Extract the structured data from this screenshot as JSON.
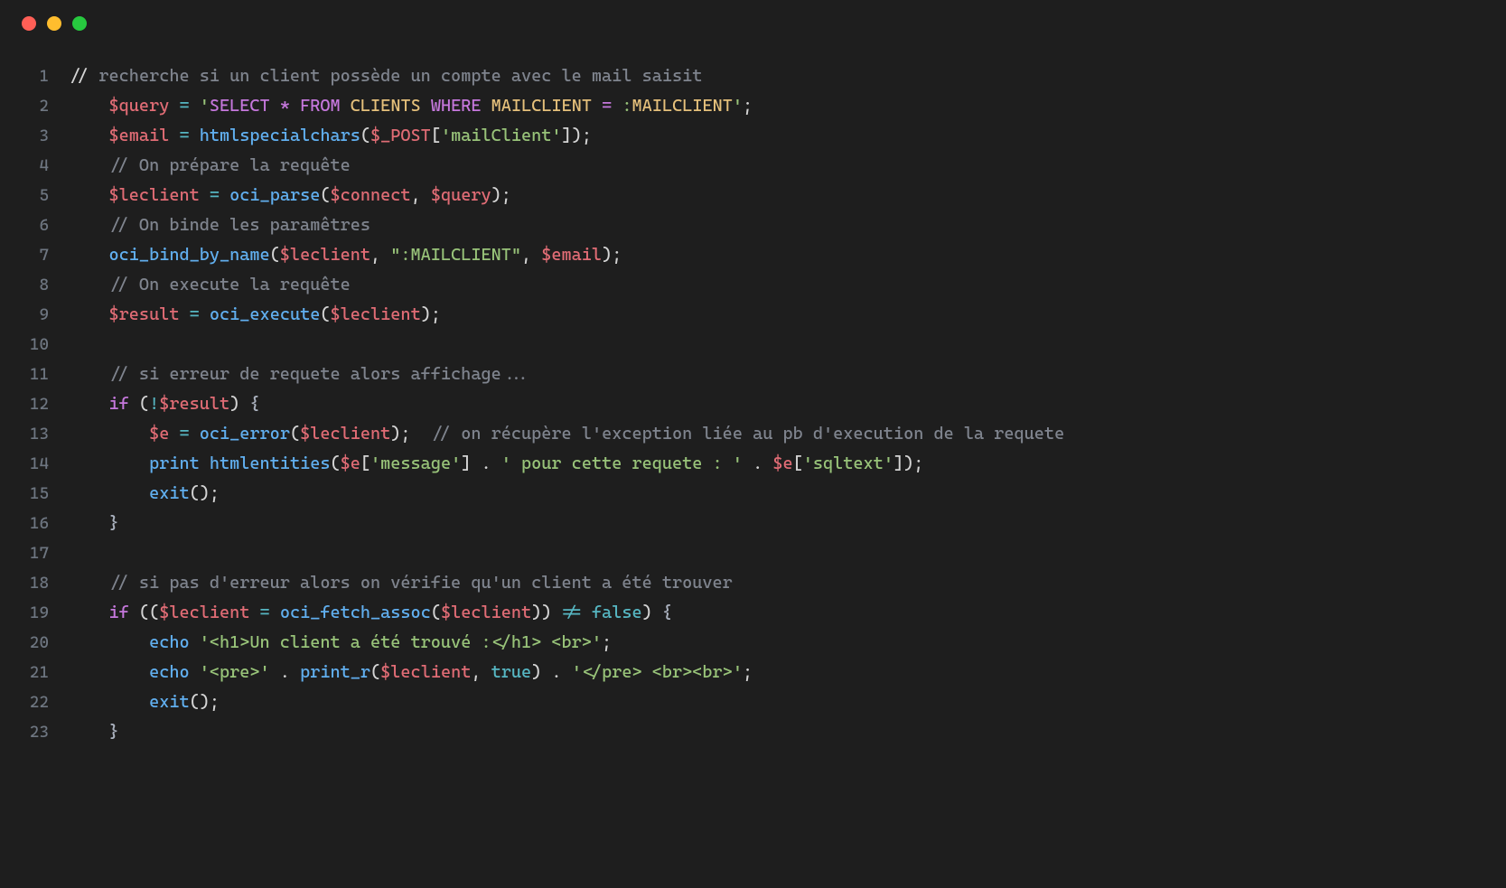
{
  "window": {
    "traffic_lights": [
      "close",
      "minimize",
      "maximize"
    ]
  },
  "code": {
    "lines": [
      {
        "no": 1,
        "tokens": [
          [
            "pn",
            "// "
          ],
          [
            "cmt",
            "recherche si un client possède un compte avec le mail saisit"
          ]
        ]
      },
      {
        "no": 2,
        "tokens": [
          [
            "pn",
            "    "
          ],
          [
            "var",
            "$query"
          ],
          [
            "pn",
            " "
          ],
          [
            "op",
            "="
          ],
          [
            "pn",
            " "
          ],
          [
            "str",
            "'"
          ],
          [
            "sql",
            "SELECT"
          ],
          [
            "str",
            " "
          ],
          [
            "sql",
            "*"
          ],
          [
            "str",
            " "
          ],
          [
            "sql",
            "FROM"
          ],
          [
            "str",
            " "
          ],
          [
            "sqlid",
            "CLIENTS"
          ],
          [
            "str",
            " "
          ],
          [
            "sql",
            "WHERE"
          ],
          [
            "str",
            " "
          ],
          [
            "sqlid",
            "MAILCLIENT"
          ],
          [
            "str",
            " "
          ],
          [
            "sql",
            "="
          ],
          [
            "str",
            " :"
          ],
          [
            "sqlid",
            "MAILCLIENT"
          ],
          [
            "str",
            "'"
          ],
          [
            "pn",
            ";"
          ]
        ]
      },
      {
        "no": 3,
        "tokens": [
          [
            "pn",
            "    "
          ],
          [
            "var",
            "$email"
          ],
          [
            "pn",
            " "
          ],
          [
            "op",
            "="
          ],
          [
            "pn",
            " "
          ],
          [
            "fn",
            "htmlspecialchars"
          ],
          [
            "pn",
            "("
          ],
          [
            "var",
            "$_POST"
          ],
          [
            "pn",
            "["
          ],
          [
            "str",
            "'mailClient'"
          ],
          [
            "pn",
            "]);"
          ]
        ]
      },
      {
        "no": 4,
        "tokens": [
          [
            "pn",
            "    "
          ],
          [
            "cmt",
            "// On prépare la requête"
          ]
        ]
      },
      {
        "no": 5,
        "tokens": [
          [
            "pn",
            "    "
          ],
          [
            "var",
            "$leclient"
          ],
          [
            "pn",
            " "
          ],
          [
            "op",
            "="
          ],
          [
            "pn",
            " "
          ],
          [
            "fn",
            "oci_parse"
          ],
          [
            "pn",
            "("
          ],
          [
            "var",
            "$connect"
          ],
          [
            "pn",
            ", "
          ],
          [
            "var",
            "$query"
          ],
          [
            "pn",
            ");"
          ]
        ]
      },
      {
        "no": 6,
        "tokens": [
          [
            "pn",
            "    "
          ],
          [
            "cmt",
            "// On binde les paramêtres"
          ]
        ]
      },
      {
        "no": 7,
        "tokens": [
          [
            "pn",
            "    "
          ],
          [
            "fn",
            "oci_bind_by_name"
          ],
          [
            "pn",
            "("
          ],
          [
            "var",
            "$leclient"
          ],
          [
            "pn",
            ", "
          ],
          [
            "str",
            "\":MAILCLIENT\""
          ],
          [
            "pn",
            ", "
          ],
          [
            "var",
            "$email"
          ],
          [
            "pn",
            ");"
          ]
        ]
      },
      {
        "no": 8,
        "tokens": [
          [
            "pn",
            "    "
          ],
          [
            "cmt",
            "// On execute la requête"
          ]
        ]
      },
      {
        "no": 9,
        "tokens": [
          [
            "pn",
            "    "
          ],
          [
            "var",
            "$result"
          ],
          [
            "pn",
            " "
          ],
          [
            "op",
            "="
          ],
          [
            "pn",
            " "
          ],
          [
            "fn",
            "oci_execute"
          ],
          [
            "pn",
            "("
          ],
          [
            "var",
            "$leclient"
          ],
          [
            "pn",
            ");"
          ]
        ]
      },
      {
        "no": 10,
        "tokens": []
      },
      {
        "no": 11,
        "tokens": [
          [
            "pn",
            "    "
          ],
          [
            "cmt",
            "// si erreur de requete alors affichage..."
          ]
        ]
      },
      {
        "no": 12,
        "tokens": [
          [
            "pn",
            "    "
          ],
          [
            "kw",
            "if"
          ],
          [
            "pn",
            " ("
          ],
          [
            "op",
            "!"
          ],
          [
            "var",
            "$result"
          ],
          [
            "pn",
            ") "
          ],
          [
            "br",
            "{"
          ]
        ]
      },
      {
        "no": 13,
        "tokens": [
          [
            "pn",
            "        "
          ],
          [
            "var",
            "$e"
          ],
          [
            "pn",
            " "
          ],
          [
            "op",
            "="
          ],
          [
            "pn",
            " "
          ],
          [
            "fn",
            "oci_error"
          ],
          [
            "pn",
            "("
          ],
          [
            "var",
            "$leclient"
          ],
          [
            "pn",
            ");  "
          ],
          [
            "cmt",
            "// on récupère l'exception liée au pb d'execution de la requete"
          ]
        ]
      },
      {
        "no": 14,
        "tokens": [
          [
            "pn",
            "        "
          ],
          [
            "echo",
            "print"
          ],
          [
            "pn",
            " "
          ],
          [
            "fn",
            "htmlentities"
          ],
          [
            "pn",
            "("
          ],
          [
            "var",
            "$e"
          ],
          [
            "pn",
            "["
          ],
          [
            "str",
            "'message'"
          ],
          [
            "pn",
            "] . "
          ],
          [
            "str",
            "' pour cette requete : '"
          ],
          [
            "pn",
            " . "
          ],
          [
            "var",
            "$e"
          ],
          [
            "pn",
            "["
          ],
          [
            "str",
            "'sqltext'"
          ],
          [
            "pn",
            "]);"
          ]
        ]
      },
      {
        "no": 15,
        "tokens": [
          [
            "pn",
            "        "
          ],
          [
            "echo",
            "exit"
          ],
          [
            "pn",
            "();"
          ]
        ]
      },
      {
        "no": 16,
        "tokens": [
          [
            "pn",
            "    "
          ],
          [
            "br",
            "}"
          ]
        ]
      },
      {
        "no": 17,
        "tokens": []
      },
      {
        "no": 18,
        "tokens": [
          [
            "pn",
            "    "
          ],
          [
            "cmt",
            "// si pas d'erreur alors on vérifie qu'un client a été trouver"
          ]
        ]
      },
      {
        "no": 19,
        "tokens": [
          [
            "pn",
            "    "
          ],
          [
            "kw",
            "if"
          ],
          [
            "pn",
            " (("
          ],
          [
            "var",
            "$leclient"
          ],
          [
            "pn",
            " "
          ],
          [
            "op",
            "="
          ],
          [
            "pn",
            " "
          ],
          [
            "fn",
            "oci_fetch_assoc"
          ],
          [
            "pn",
            "("
          ],
          [
            "var",
            "$leclient"
          ],
          [
            "pn",
            ")) "
          ],
          [
            "op",
            "!="
          ],
          [
            "pn",
            " "
          ],
          [
            "num",
            "false"
          ],
          [
            "pn",
            ") "
          ],
          [
            "br",
            "{"
          ]
        ]
      },
      {
        "no": 20,
        "tokens": [
          [
            "pn",
            "        "
          ],
          [
            "echo",
            "echo"
          ],
          [
            "pn",
            " "
          ],
          [
            "str",
            "'<h1>Un client a été trouvé :</h1> <br>'"
          ],
          [
            "pn",
            ";"
          ]
        ]
      },
      {
        "no": 21,
        "tokens": [
          [
            "pn",
            "        "
          ],
          [
            "echo",
            "echo"
          ],
          [
            "pn",
            " "
          ],
          [
            "str",
            "'<pre>'"
          ],
          [
            "pn",
            " . "
          ],
          [
            "fn",
            "print_r"
          ],
          [
            "pn",
            "("
          ],
          [
            "var",
            "$leclient"
          ],
          [
            "pn",
            ", "
          ],
          [
            "num",
            "true"
          ],
          [
            "pn",
            ") . "
          ],
          [
            "str",
            "'</pre> <br><br>'"
          ],
          [
            "pn",
            ";"
          ]
        ]
      },
      {
        "no": 22,
        "tokens": [
          [
            "pn",
            "        "
          ],
          [
            "echo",
            "exit"
          ],
          [
            "pn",
            "();"
          ]
        ]
      },
      {
        "no": 23,
        "tokens": [
          [
            "pn",
            "    "
          ],
          [
            "br",
            "}"
          ]
        ]
      }
    ]
  }
}
